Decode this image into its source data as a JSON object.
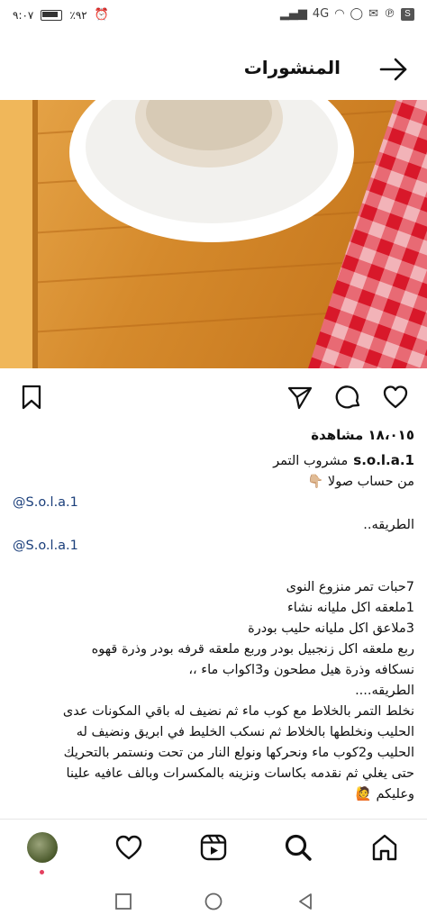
{
  "status_bar": {
    "time": "٩:٠٧",
    "battery": "٪٩٢",
    "network": "4G"
  },
  "header": {
    "title": "المنشورات"
  },
  "post": {
    "views": "١٨،٠١٥ مشاهدة",
    "username": "s.o.l.a.1",
    "caption_lines": [
      "مشروب التمر",
      "من حساب صولا 👇🏼",
      "@S.o.l.a.1",
      "الطريقه..",
      "@S.o.l.a.1",
      "7حبات تمر منزوع النوى",
      "1ملعقه اكل مليانه نشاء",
      "3ملاعق اكل مليانه حليب بودرة",
      "ربع ملعقه اكل زنجبيل بودر  وربع ملعقه قرفه بودر وذرة قهوه",
      "نسكافه وذرة هيل مطحون و3اكواب ماء ،،",
      "الطريقه....",
      "نخلط التمر بالخلاط مع كوب ماء ثم نضيف له باقي المكونات عدى",
      "الحليب ونخلطها بالخلاط ثم نسكب الخليط في ابريق ونضيف له",
      "الحليب و2كوب ماء ونحركها ونولع النار من تحت ونستمر بالتحريك",
      "حتى يغلي ثم نقدمه بكاسات ونزينه بالمكسرات وبالف عافيه علينا",
      "وعليكم 🙋"
    ]
  },
  "icons": {
    "back": "arrow-right-icon",
    "like": "heart-icon",
    "comment": "comment-icon",
    "share": "send-icon",
    "save": "bookmark-icon",
    "nav": [
      "home-icon",
      "search-icon",
      "reels-icon",
      "heart-icon",
      "profile-avatar"
    ]
  },
  "colors": {
    "mention": "#1a3e7a",
    "notification_dot": "#e4405f"
  }
}
